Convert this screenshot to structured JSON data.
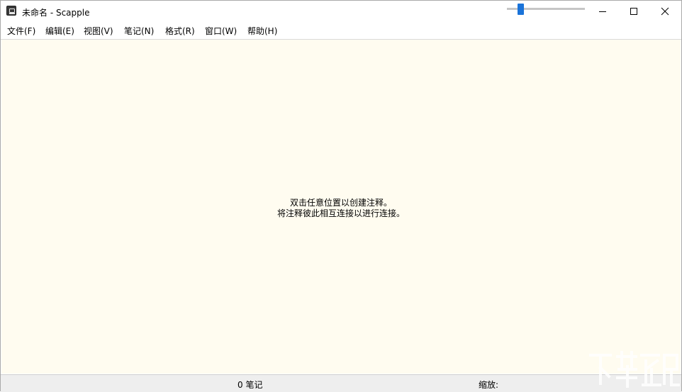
{
  "window": {
    "title": "未命名 - Scapple"
  },
  "menu": {
    "items": [
      "文件(F)",
      "编辑(E)",
      "视图(V)",
      "笔记(N)",
      "格式(R)",
      "窗口(W)",
      "帮助(H)"
    ]
  },
  "canvas": {
    "background": "#fffcf0",
    "hint_line1": "双击任意位置以创建注释。",
    "hint_line2": "将注释彼此相互连接以进行连接。"
  },
  "status": {
    "note_count": "0 笔记",
    "zoom_label": "缩放:",
    "accent": "#1a73d9"
  },
  "icons": [
    "app-icon",
    "minimize-icon",
    "maximize-icon",
    "close-icon",
    "watermark-logo"
  ]
}
